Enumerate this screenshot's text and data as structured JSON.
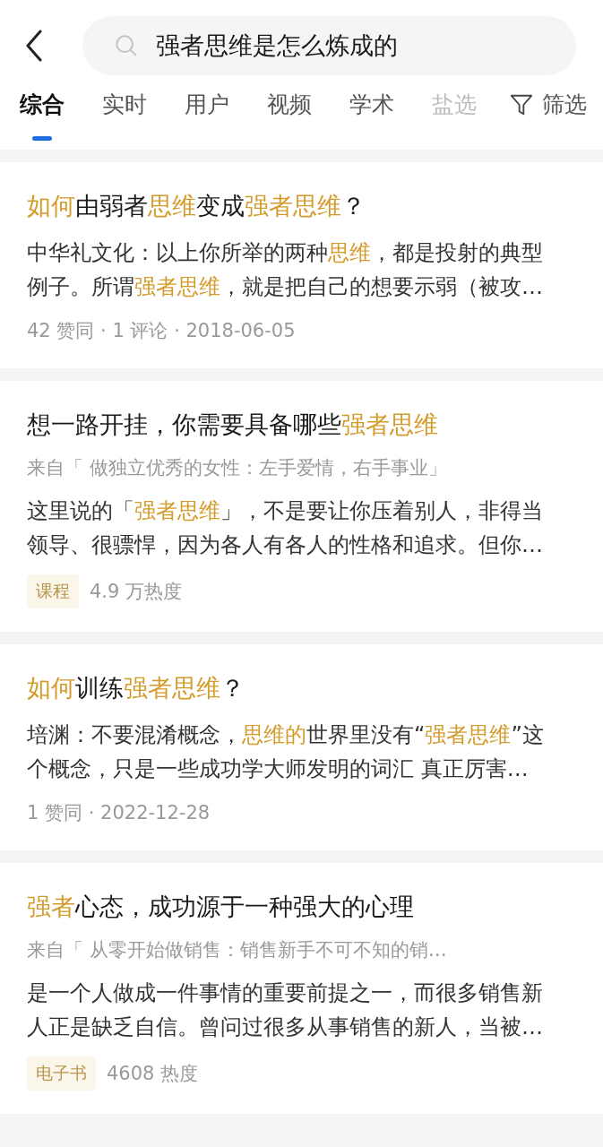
{
  "search": {
    "value": "强者思维是怎么炼成的"
  },
  "tabs": [
    {
      "label": "综合",
      "selected": true
    },
    {
      "label": "实时",
      "selected": false
    },
    {
      "label": "用户",
      "selected": false
    },
    {
      "label": "视频",
      "selected": false
    },
    {
      "label": "学术",
      "selected": false
    },
    {
      "label": "盐选",
      "selected": false
    }
  ],
  "filter": {
    "label": "筛选"
  },
  "results": [
    {
      "title": [
        {
          "text": "如何",
          "highlight": true
        },
        {
          "text": "由弱者",
          "highlight": false
        },
        {
          "text": "思维",
          "highlight": true
        },
        {
          "text": "变成",
          "highlight": false
        },
        {
          "text": "强者思维",
          "highlight": true
        },
        {
          "text": "？",
          "highlight": false
        }
      ],
      "excerpt": [
        {
          "text": "中华礼文化：以上你所举的两种",
          "highlight": false
        },
        {
          "text": "思维",
          "highlight": true
        },
        {
          "text": "，都是投射的典型例子。所谓",
          "highlight": false
        },
        {
          "text": "强者思维",
          "highlight": true
        },
        {
          "text": "，就是把自己的想要示弱（被攻…",
          "highlight": false
        }
      ],
      "meta": "42 赞同 · 1 评论 · 2018-06-05"
    },
    {
      "title": [
        {
          "text": "想一路开挂，你需要具备哪些",
          "highlight": false
        },
        {
          "text": "强者思维",
          "highlight": true
        }
      ],
      "source": "来自「 做独立优秀的女性：左手爱情，右手事业」",
      "excerpt": [
        {
          "text": "这里说的「",
          "highlight": false
        },
        {
          "text": "强者思维",
          "highlight": true
        },
        {
          "text": "」，不是要让你压着别人，非得当领导、很骠悍，因为各人有各人的性格和追求。但你…",
          "highlight": false
        }
      ],
      "tag": "课程",
      "meta": "4.9 万热度"
    },
    {
      "title": [
        {
          "text": "如何",
          "highlight": true
        },
        {
          "text": "训练",
          "highlight": false
        },
        {
          "text": "强者思维",
          "highlight": true
        },
        {
          "text": "？",
          "highlight": false
        }
      ],
      "excerpt": [
        {
          "text": "培渊：不要混淆概念，",
          "highlight": false
        },
        {
          "text": "思维的",
          "highlight": true
        },
        {
          "text": "世界里没有“",
          "highlight": false
        },
        {
          "text": "强者思维",
          "highlight": true
        },
        {
          "text": "”这个概念，只是一些成功学大师发明的词汇 真正厉害…",
          "highlight": false
        }
      ],
      "meta": "1 赞同 · 2022-12-28"
    },
    {
      "title": [
        {
          "text": "强者",
          "highlight": true
        },
        {
          "text": "心态，成功源于一种强大的心理",
          "highlight": false
        }
      ],
      "source": "来自「 从零开始做销售：销售新手不可不知的销…",
      "excerpt": [
        {
          "text": "是一个人做成一件事情的重要前提之一，而很多销售新人正是缺乏自信。曾问过很多从事销售的新人，当被…",
          "highlight": false
        }
      ],
      "tag": "电子书",
      "meta": "4608 热度"
    }
  ]
}
